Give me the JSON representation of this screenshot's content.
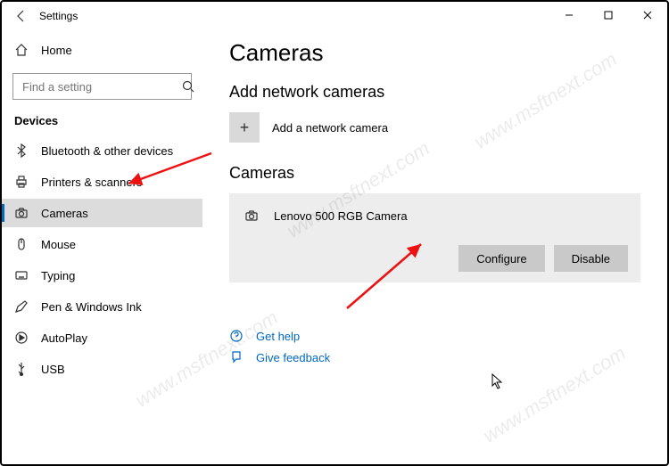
{
  "window": {
    "title": "Settings"
  },
  "sidebar": {
    "home": "Home",
    "search_placeholder": "Find a setting",
    "category": "Devices",
    "items": [
      {
        "label": "Bluetooth & other devices"
      },
      {
        "label": "Printers & scanners"
      },
      {
        "label": "Cameras"
      },
      {
        "label": "Mouse"
      },
      {
        "label": "Typing"
      },
      {
        "label": "Pen & Windows Ink"
      },
      {
        "label": "AutoPlay"
      },
      {
        "label": "USB"
      }
    ]
  },
  "content": {
    "page_title": "Cameras",
    "add_section": "Add network cameras",
    "add_label": "Add a network camera",
    "list_section": "Cameras",
    "device_name": "Lenovo 500 RGB Camera",
    "configure": "Configure",
    "disable": "Disable",
    "get_help": "Get help",
    "give_feedback": "Give feedback"
  },
  "watermark": "www.msftnext.com"
}
